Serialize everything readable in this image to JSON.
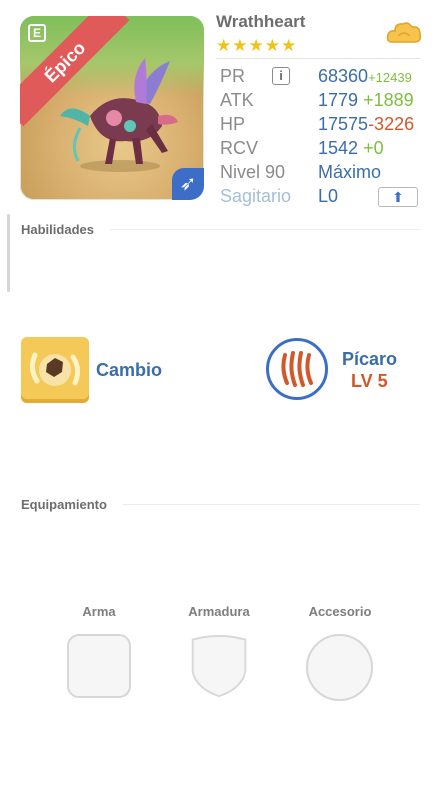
{
  "card": {
    "rarity_label": "Épico",
    "corner_icon": "calendar-icon",
    "class_badge_icon": "arrow-icon"
  },
  "hero": {
    "name": "Wrathheart",
    "stars": "★★★★★"
  },
  "stats": {
    "pr_label": "PR",
    "pr_value": "68360",
    "pr_bonus": "+12439",
    "atk_label": "ATK",
    "atk_value": "1779",
    "atk_bonus": "+1889",
    "hp_label": "HP",
    "hp_value": "17575",
    "hp_bonus": "-3226",
    "rcv_label": "RCV",
    "rcv_value": "1542",
    "rcv_bonus": "+0",
    "level_label": "Nivel 90",
    "level_value": "Máximo",
    "sign_label": "Sagitario",
    "sign_value": "L0"
  },
  "sections": {
    "skills_title": "Habilidades",
    "equipment_title": "Equipamiento"
  },
  "skill": {
    "name": "Cambio",
    "icon": "cambio-skill-icon"
  },
  "hero_class": {
    "name": "Pícaro",
    "level": "LV 5",
    "icon": "claw-icon"
  },
  "equipment": {
    "weapon_label": "Arma",
    "armor_label": "Armadura",
    "accessory_label": "Accesorio"
  },
  "colors": {
    "accent_blue": "#3b6ea8",
    "bonus_green": "#7fbf3e",
    "penalty_orange": "#d2582a",
    "rarity_red": "#e05a5a",
    "star_gold": "#f2c21c"
  }
}
